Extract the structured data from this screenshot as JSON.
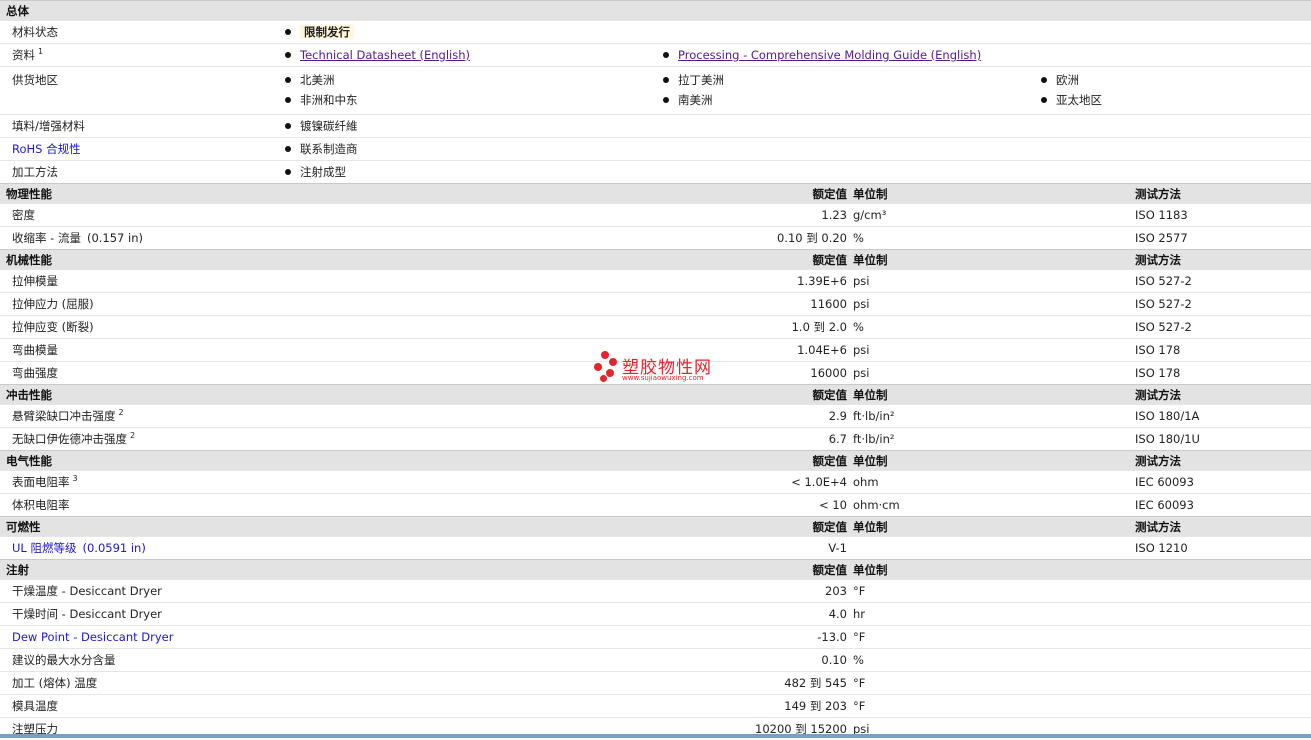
{
  "general": {
    "title": "总体",
    "status_label": "材料状态",
    "status_value": "限制发行",
    "docs_label": "资料",
    "docs_sup": "1",
    "doc1": "Technical Datasheet (English)",
    "doc2": "Processing - Comprehensive Molding Guide (English)",
    "avail_label": "供货地区",
    "regions": [
      "北美洲",
      "拉丁美洲",
      "欧洲",
      "非洲和中东",
      "南美洲",
      "亚太地区"
    ],
    "filler_label": "填料/增强材料",
    "filler_value": "镀镍碳纤維",
    "rohs_label": "RoHS 合规性",
    "rohs_value": "联系制造商",
    "process_label": "加工方法",
    "process_value": "注射成型"
  },
  "headers": {
    "value": "额定值",
    "unit": "单位制",
    "method": "测试方法"
  },
  "physical": {
    "title": "物理性能",
    "rows": [
      {
        "name": "密度",
        "value": "1.23",
        "unit": "g/cm³",
        "method": "ISO 1183"
      },
      {
        "name": "收缩率  - 流量",
        "extra": "(0.157 in)",
        "value": "0.10 到  0.20",
        "unit": "%",
        "method": "ISO 2577"
      }
    ]
  },
  "mechanical": {
    "title": "机械性能",
    "rows": [
      {
        "name": "拉伸模量",
        "value": "1.39E+6",
        "unit": "psi",
        "method": "ISO 527-2"
      },
      {
        "name": "拉伸应力 (屈服)",
        "value": "11600",
        "unit": "psi",
        "method": "ISO 527-2"
      },
      {
        "name": "拉伸应变 (断裂)",
        "value": "1.0 到  2.0",
        "unit": "%",
        "method": "ISO 527-2"
      },
      {
        "name": "弯曲模量",
        "value": "1.04E+6",
        "unit": "psi",
        "method": "ISO 178"
      },
      {
        "name": "弯曲强度",
        "value": "16000",
        "unit": "psi",
        "method": "ISO 178"
      }
    ]
  },
  "impact": {
    "title": "冲击性能",
    "rows": [
      {
        "name": "悬臂梁缺口冲击强度",
        "sup": "2",
        "value": "2.9",
        "unit": "ft·lb/in²",
        "method": "ISO 180/1A"
      },
      {
        "name": "无缺口伊佐德冲击强度",
        "sup": "2",
        "value": "6.7",
        "unit": "ft·lb/in²",
        "method": "ISO 180/1U"
      }
    ]
  },
  "electrical": {
    "title": "电气性能",
    "rows": [
      {
        "name": "表面电阻率",
        "sup": "3",
        "value": "< 1.0E+4",
        "unit": "ohm",
        "method": "IEC 60093"
      },
      {
        "name": "体积电阻率",
        "value": "< 10",
        "unit": "ohm·cm",
        "method": "IEC 60093"
      }
    ]
  },
  "flammability": {
    "title": "可燃性",
    "rows": [
      {
        "name": "UL 阻燃等级",
        "extra": "(0.0591 in)",
        "value": "V-1",
        "unit": "",
        "method": "ISO 1210"
      }
    ]
  },
  "injection": {
    "title": "注射",
    "rows": [
      {
        "name": "干燥温度  - Desiccant Dryer",
        "value": "203",
        "unit": "°F"
      },
      {
        "name": "干燥时间  - Desiccant Dryer",
        "value": "4.0",
        "unit": "hr"
      },
      {
        "name": "Dew Point - Desiccant Dryer",
        "value": "-13.0",
        "unit": "°F"
      },
      {
        "name": "建议的最大水分含量",
        "value": "0.10",
        "unit": "%"
      },
      {
        "name": "加工 (熔体) 温度",
        "value": "482 到  545",
        "unit": "°F"
      },
      {
        "name": "模具温度",
        "value": "149 到  203",
        "unit": "°F"
      },
      {
        "name": "注塑压力",
        "value": "10200 到  15200",
        "unit": "psi"
      }
    ]
  },
  "watermark": {
    "text": "塑胶物性网",
    "url": "www.sujiaowuxing.com",
    "color": "#e0262a"
  }
}
